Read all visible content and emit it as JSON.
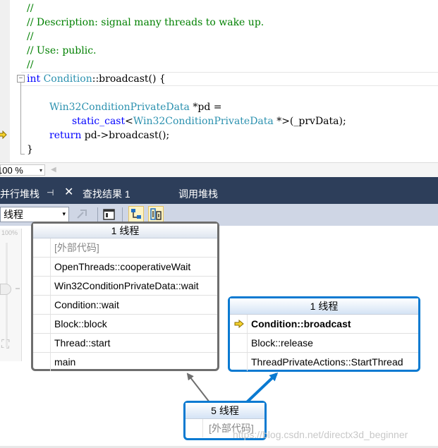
{
  "editor": {
    "lines": [
      "//",
      "// Description: signal many threads to wake up.",
      "//",
      "// Use: public.",
      "//"
    ],
    "func_keyword": "int",
    "func_class": "Condition",
    "func_rest": "::broadcast() {",
    "decl_type": "Win32ConditionPrivateData",
    "decl_rest": " *pd =",
    "cast_kw": "static_cast",
    "cast_lt": "<",
    "cast_type": "Win32ConditionPrivateData",
    "cast_rest": " *>(_prvData);",
    "ret_kw": "return",
    "ret_rest": " pd->broadcast();",
    "close_brace": "}",
    "fold_glyph": "−"
  },
  "zoom": {
    "value": "100 %"
  },
  "tabs": {
    "parallel_stacks": "并行堆栈",
    "find_results": "查找结果 1",
    "call_stack": "调用堆栈",
    "pin_glyph": "⊣",
    "close_glyph": "✕"
  },
  "toolbar": {
    "view_select": "线程",
    "dd": "▾"
  },
  "zoom_panel": {
    "label": "100%",
    "fit_glyph": "⛶"
  },
  "nodes": {
    "main_thread": {
      "header": "1 线程",
      "frames": [
        "[外部代码]",
        "OpenThreads::cooperativeWait",
        "Win32ConditionPrivateData::wait",
        "Condition::wait",
        "Block::block",
        "Thread::start",
        "main"
      ]
    },
    "current_thread": {
      "header": "1 线程",
      "frames": [
        "Condition::broadcast",
        "Block::release",
        "ThreadPrivateActions::StartThread"
      ]
    },
    "root": {
      "header": "5 线程",
      "frames": [
        "[外部代码]"
      ]
    }
  },
  "watermark": "https://blog.csdn.net/directx3d_beginner",
  "colors": {
    "tab_bg": "#2d3e5a",
    "toolbar_bg": "#cfd6e5",
    "node_blue": "#0a7ad1",
    "node_gray": "#6e6e6e",
    "arrow_yellow": "#f6d32d",
    "comment": "#008000",
    "keyword": "#0000ff",
    "type": "#2b91af"
  }
}
